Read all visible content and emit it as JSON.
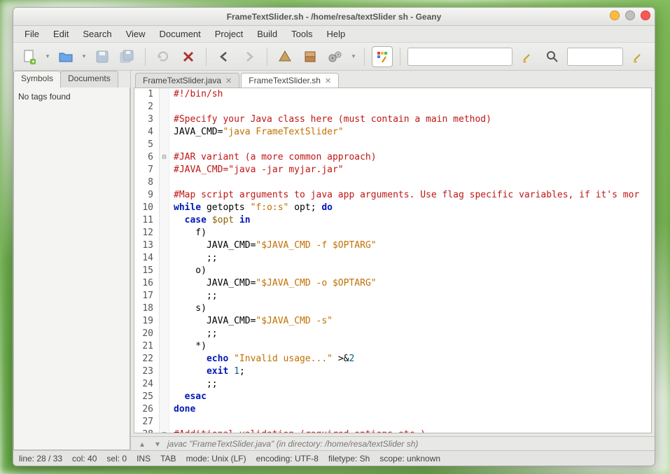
{
  "window": {
    "title": "FrameTextSlider.sh - /home/resa/textSlider sh - Geany"
  },
  "menu": [
    "File",
    "Edit",
    "Search",
    "View",
    "Document",
    "Project",
    "Build",
    "Tools",
    "Help"
  ],
  "sidebar": {
    "tabs": [
      "Symbols",
      "Documents"
    ],
    "active_tab": 0,
    "message": "No tags found"
  },
  "file_tabs": [
    {
      "label": "FrameTextSlider.java",
      "active": false
    },
    {
      "label": "FrameTextSlider.sh",
      "active": true
    }
  ],
  "code": {
    "lines": [
      {
        "n": 1,
        "fold": "",
        "segments": [
          [
            "comment",
            "#!/bin/sh"
          ]
        ]
      },
      {
        "n": 2,
        "fold": "",
        "segments": []
      },
      {
        "n": 3,
        "fold": "",
        "segments": [
          [
            "comment",
            "#Specify your Java class here (must contain a main method)"
          ]
        ]
      },
      {
        "n": 4,
        "fold": "",
        "segments": [
          [
            "plain",
            "JAVA_CMD="
          ],
          [
            "str",
            "\"java FrameTextSlider\""
          ]
        ]
      },
      {
        "n": 5,
        "fold": "",
        "segments": []
      },
      {
        "n": 6,
        "fold": "⊟",
        "segments": [
          [
            "comment",
            "#JAR variant (a more common approach)"
          ]
        ]
      },
      {
        "n": 7,
        "fold": "",
        "segments": [
          [
            "comment",
            "#JAVA_CMD=\"java -jar myjar.jar\""
          ]
        ]
      },
      {
        "n": 8,
        "fold": "",
        "segments": []
      },
      {
        "n": 9,
        "fold": "",
        "segments": [
          [
            "comment",
            "#Map script arguments to java app arguments. Use flag specific variables, if it's mor"
          ]
        ]
      },
      {
        "n": 10,
        "fold": "",
        "segments": [
          [
            "kw",
            "while"
          ],
          [
            "plain",
            " getopts "
          ],
          [
            "str",
            "\"f:o:s\""
          ],
          [
            "plain",
            " opt; "
          ],
          [
            "kw",
            "do"
          ]
        ]
      },
      {
        "n": 11,
        "fold": "",
        "segments": [
          [
            "plain",
            "  "
          ],
          [
            "kw",
            "case"
          ],
          [
            "plain",
            " "
          ],
          [
            "var",
            "$opt"
          ],
          [
            "plain",
            " "
          ],
          [
            "kw",
            "in"
          ]
        ]
      },
      {
        "n": 12,
        "fold": "",
        "segments": [
          [
            "plain",
            "    f)"
          ]
        ]
      },
      {
        "n": 13,
        "fold": "",
        "segments": [
          [
            "plain",
            "      JAVA_CMD="
          ],
          [
            "str",
            "\"$JAVA_CMD -f $OPTARG\""
          ]
        ]
      },
      {
        "n": 14,
        "fold": "",
        "segments": [
          [
            "plain",
            "      ;;"
          ]
        ]
      },
      {
        "n": 15,
        "fold": "",
        "segments": [
          [
            "plain",
            "    o)"
          ]
        ]
      },
      {
        "n": 16,
        "fold": "",
        "segments": [
          [
            "plain",
            "      JAVA_CMD="
          ],
          [
            "str",
            "\"$JAVA_CMD -o $OPTARG\""
          ]
        ]
      },
      {
        "n": 17,
        "fold": "",
        "segments": [
          [
            "plain",
            "      ;;"
          ]
        ]
      },
      {
        "n": 18,
        "fold": "",
        "segments": [
          [
            "plain",
            "    s)"
          ]
        ]
      },
      {
        "n": 19,
        "fold": "",
        "segments": [
          [
            "plain",
            "      JAVA_CMD="
          ],
          [
            "str",
            "\"$JAVA_CMD -s\""
          ]
        ]
      },
      {
        "n": 20,
        "fold": "",
        "segments": [
          [
            "plain",
            "      ;;"
          ]
        ]
      },
      {
        "n": 21,
        "fold": "",
        "segments": [
          [
            "plain",
            "    *)"
          ]
        ]
      },
      {
        "n": 22,
        "fold": "",
        "segments": [
          [
            "plain",
            "      "
          ],
          [
            "kw",
            "echo"
          ],
          [
            "plain",
            " "
          ],
          [
            "str",
            "\"Invalid usage...\""
          ],
          [
            "plain",
            " >&"
          ],
          [
            "num",
            "2"
          ]
        ]
      },
      {
        "n": 23,
        "fold": "",
        "segments": [
          [
            "plain",
            "      "
          ],
          [
            "kw",
            "exit"
          ],
          [
            "plain",
            " "
          ],
          [
            "num",
            "1"
          ],
          [
            "plain",
            ";"
          ]
        ]
      },
      {
        "n": 24,
        "fold": "",
        "segments": [
          [
            "plain",
            "      ;;"
          ]
        ]
      },
      {
        "n": 25,
        "fold": "",
        "segments": [
          [
            "plain",
            "  "
          ],
          [
            "kw",
            "esac"
          ]
        ]
      },
      {
        "n": 26,
        "fold": "",
        "segments": [
          [
            "kw",
            "done"
          ]
        ]
      },
      {
        "n": 27,
        "fold": "",
        "segments": []
      },
      {
        "n": 28,
        "fold": "⊟",
        "segments": [
          [
            "comment",
            "#Additional validation (required options etc.)"
          ]
        ]
      }
    ]
  },
  "compiler": {
    "text": "javac \"FrameTextSlider.java\" (in directory: /home/resa/textSlider sh)"
  },
  "status": {
    "line": "line: 28 / 33",
    "col": "col: 40",
    "sel": "sel: 0",
    "ins": "INS",
    "tab": "TAB",
    "mode": "mode: Unix (LF)",
    "encoding": "encoding: UTF-8",
    "filetype": "filetype: Sh",
    "scope": "scope: unknown"
  }
}
